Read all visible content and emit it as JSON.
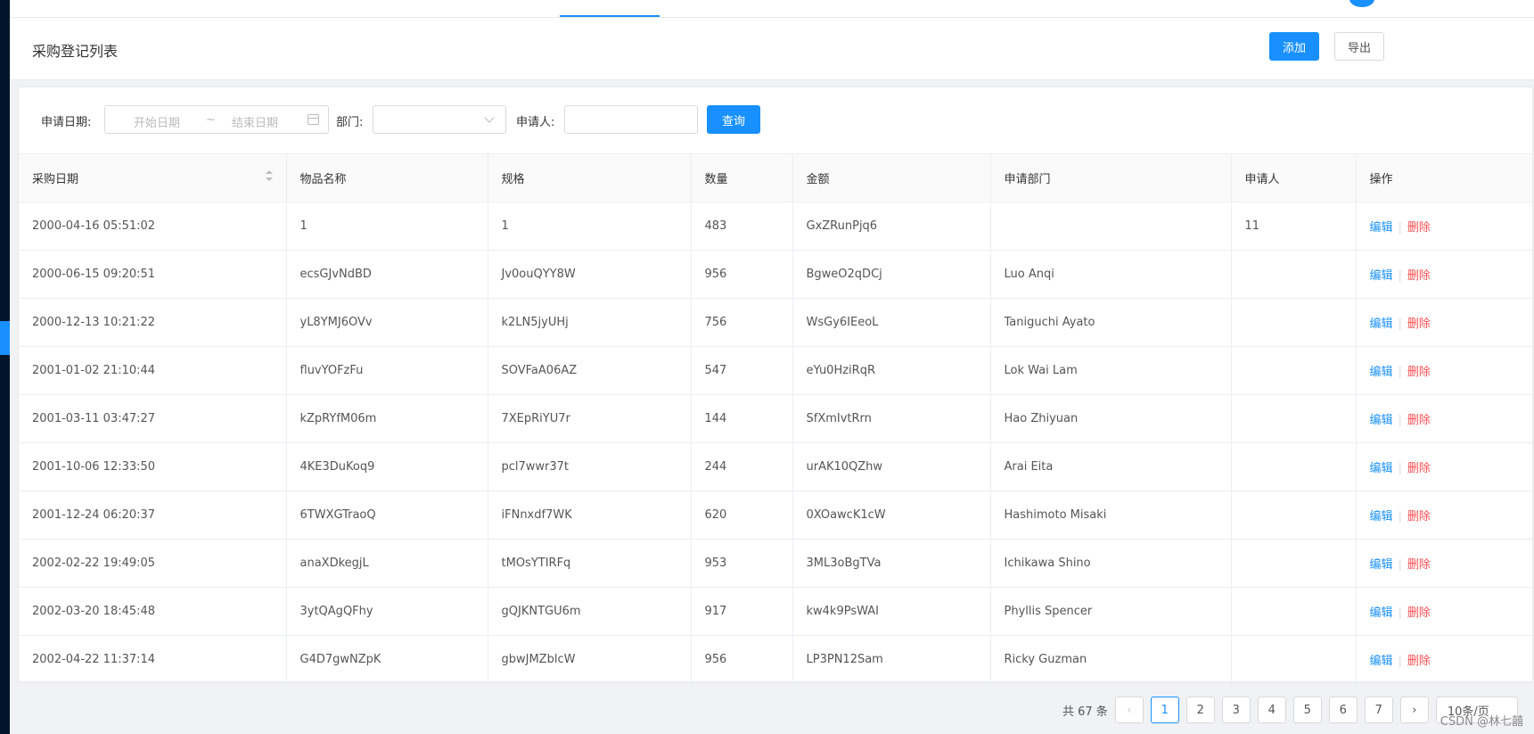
{
  "page": {
    "title": "采购登记列表",
    "add_label": "添加",
    "export_label": "导出"
  },
  "filters": {
    "date_label": "申请日期:",
    "start_placeholder": "开始日期",
    "range_sep": "~",
    "end_placeholder": "结束日期",
    "dept_label": "部门:",
    "applicant_label": "申请人:",
    "query_label": "查询"
  },
  "table": {
    "columns": [
      "采购日期",
      "物品名称",
      "规格",
      "数量",
      "金额",
      "申请部门",
      "申请人",
      "操作"
    ],
    "edit_label": "编辑",
    "delete_label": "删除",
    "rows": [
      [
        "2000-04-16 05:51:02",
        "1",
        "1",
        "483",
        "GxZRunPjq6",
        "",
        "11"
      ],
      [
        "2000-06-15 09:20:51",
        "ecsGJvNdBD",
        "Jv0ouQYY8W",
        "956",
        "BgweO2qDCj",
        "Luo Anqi",
        ""
      ],
      [
        "2000-12-13 10:21:22",
        "yL8YMJ6OVv",
        "k2LN5jyUHj",
        "756",
        "WsGy6IEeoL",
        "Taniguchi Ayato",
        ""
      ],
      [
        "2001-01-02 21:10:44",
        "fluvYOFzFu",
        "SOVFaA06AZ",
        "547",
        "eYu0HziRqR",
        "Lok Wai Lam",
        ""
      ],
      [
        "2001-03-11 03:47:27",
        "kZpRYfM06m",
        "7XEpRiYU7r",
        "144",
        "SfXmIvtRrn",
        "Hao Zhiyuan",
        ""
      ],
      [
        "2001-10-06 12:33:50",
        "4KE3DuKoq9",
        "pcl7wwr37t",
        "244",
        "urAK10QZhw",
        "Arai Eita",
        ""
      ],
      [
        "2001-12-24 06:20:37",
        "6TWXGTraoQ",
        "iFNnxdf7WK",
        "620",
        "0XOawcK1cW",
        "Hashimoto Misaki",
        ""
      ],
      [
        "2002-02-22 19:49:05",
        "anaXDkegjL",
        "tMOsYTIRFq",
        "953",
        "3ML3oBgTVa",
        "Ichikawa Shino",
        ""
      ],
      [
        "2002-03-20 18:45:48",
        "3ytQAgQFhy",
        "gQJKNTGU6m",
        "917",
        "kw4k9PsWAI",
        "Phyllis Spencer",
        ""
      ],
      [
        "2002-04-22 11:37:14",
        "G4D7gwNZpK",
        "gbwJMZblcW",
        "956",
        "LP3PN12Sam",
        "Ricky Guzman",
        ""
      ]
    ]
  },
  "pagination": {
    "total_text": "共 67 条",
    "prev": "‹",
    "next": "›",
    "pages": [
      "1",
      "2",
      "3",
      "4",
      "5",
      "6",
      "7"
    ],
    "current": "1",
    "page_size": "10条/页"
  },
  "watermark": "CSDN @林七囍",
  "colors": {
    "primary": "#1890ff",
    "danger": "#ff4d4f",
    "sidebar": "#001529"
  }
}
